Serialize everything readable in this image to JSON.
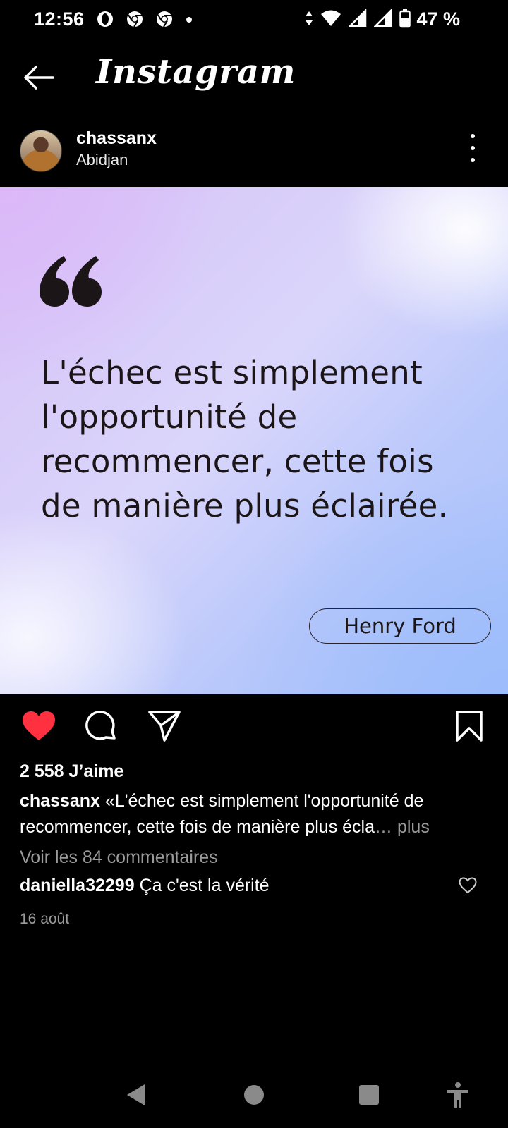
{
  "status_bar": {
    "time": "12:56",
    "battery": "47 %",
    "left_icons": [
      "opera-icon",
      "chrome-icon",
      "chrome-icon",
      "notification-dot-icon"
    ],
    "right_icons": [
      "data-arrows-icon",
      "wifi-icon",
      "signal-icon",
      "signal-icon",
      "battery-icon"
    ]
  },
  "header": {
    "logo": "Instagram"
  },
  "post": {
    "username": "chassanx",
    "location": "Abidjan",
    "image": {
      "quote_lines": [
        "L'échec est simplement",
        "l'opportunité de",
        "recommencer, cette fois",
        "de manière plus éclairée."
      ],
      "author": "Henry Ford"
    },
    "likes": "2 558 J’aime",
    "caption_user": "chassanx",
    "caption_text": "«L'échec est simplement l'opportunité de recommencer, cette fois de manière plus écla",
    "caption_ellipsis": "…",
    "caption_more": "plus",
    "view_comments": "Voir les 84 commentaires",
    "comment": {
      "user": "daniella32299",
      "text": "Ça c'est la vérité"
    },
    "date": "16 août"
  },
  "colors": {
    "like_red": "#ff3040",
    "muted": "#9a9a9a",
    "quote_ink": "#1b1517"
  }
}
